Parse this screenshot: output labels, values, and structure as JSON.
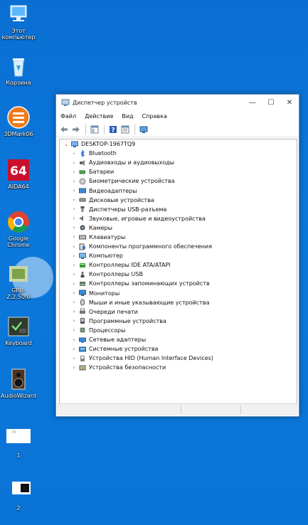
{
  "desktop": {
    "icons": [
      {
        "label": "Этот компьютер",
        "icon": "computer-icon"
      },
      {
        "label": "Корзина",
        "icon": "recycle-bin-icon"
      },
      {
        "label": "3DMark06",
        "icon": "3dmark-icon"
      },
      {
        "label": "AIDA64",
        "icon": "aida64-icon"
      },
      {
        "label": "Google Chrome",
        "icon": "chrome-icon"
      },
      {
        "label": "GPU-Z.2.50.0",
        "icon": "gpuz-icon"
      },
      {
        "label": "Keyboard",
        "icon": "keyboard-test-icon"
      },
      {
        "label": "AudioWizard",
        "icon": "speaker-icon"
      },
      {
        "label": "1",
        "icon": "image-file-icon"
      },
      {
        "label": "2",
        "icon": "image-file-icon"
      }
    ]
  },
  "window": {
    "title": "Диспетчер устройств",
    "controls": {
      "minimize": "—",
      "maximize": "☐",
      "close": "✕"
    },
    "menu": [
      "Файл",
      "Действие",
      "Вид",
      "Справка"
    ],
    "tree": {
      "root": "DESKTOP-1967TQ9",
      "items": [
        {
          "label": "Bluetooth",
          "icon": "bluetooth-icon"
        },
        {
          "label": "Аудиовходы и аудиовыходы",
          "icon": "audio-io-icon"
        },
        {
          "label": "Батареи",
          "icon": "battery-icon"
        },
        {
          "label": "Биометрические устройства",
          "icon": "fingerprint-icon"
        },
        {
          "label": "Видеоадаптеры",
          "icon": "display-adapter-icon"
        },
        {
          "label": "Дисковые устройства",
          "icon": "disk-icon"
        },
        {
          "label": "Диспетчеры USB-разъема",
          "icon": "usb-icon"
        },
        {
          "label": "Звуковые, игровые и видеоустройства",
          "icon": "sound-icon"
        },
        {
          "label": "Камеры",
          "icon": "camera-icon"
        },
        {
          "label": "Клавиатуры",
          "icon": "keyboard-icon"
        },
        {
          "label": "Компоненты программного обеспечения",
          "icon": "software-component-icon"
        },
        {
          "label": "Компьютер",
          "icon": "computer-icon"
        },
        {
          "label": "Контроллеры IDE ATA/ATAPI",
          "icon": "ide-icon"
        },
        {
          "label": "Контроллеры USB",
          "icon": "usb-controller-icon"
        },
        {
          "label": "Контроллеры запоминающих устройств",
          "icon": "storage-controller-icon"
        },
        {
          "label": "Мониторы",
          "icon": "monitor-icon"
        },
        {
          "label": "Мыши и иные указывающие устройства",
          "icon": "mouse-icon"
        },
        {
          "label": "Очереди печати",
          "icon": "printer-icon"
        },
        {
          "label": "Программные устройства",
          "icon": "software-device-icon"
        },
        {
          "label": "Процессоры",
          "icon": "processor-icon"
        },
        {
          "label": "Сетевые адаптеры",
          "icon": "network-adapter-icon"
        },
        {
          "label": "Системные устройства",
          "icon": "system-device-icon"
        },
        {
          "label": "Устройства HID (Human Interface Devices)",
          "icon": "hid-icon"
        },
        {
          "label": "Устройства безопасности",
          "icon": "security-device-icon"
        }
      ]
    }
  },
  "colors": {
    "desktop": "#0a74d6",
    "accent": "#1a6ad6"
  }
}
